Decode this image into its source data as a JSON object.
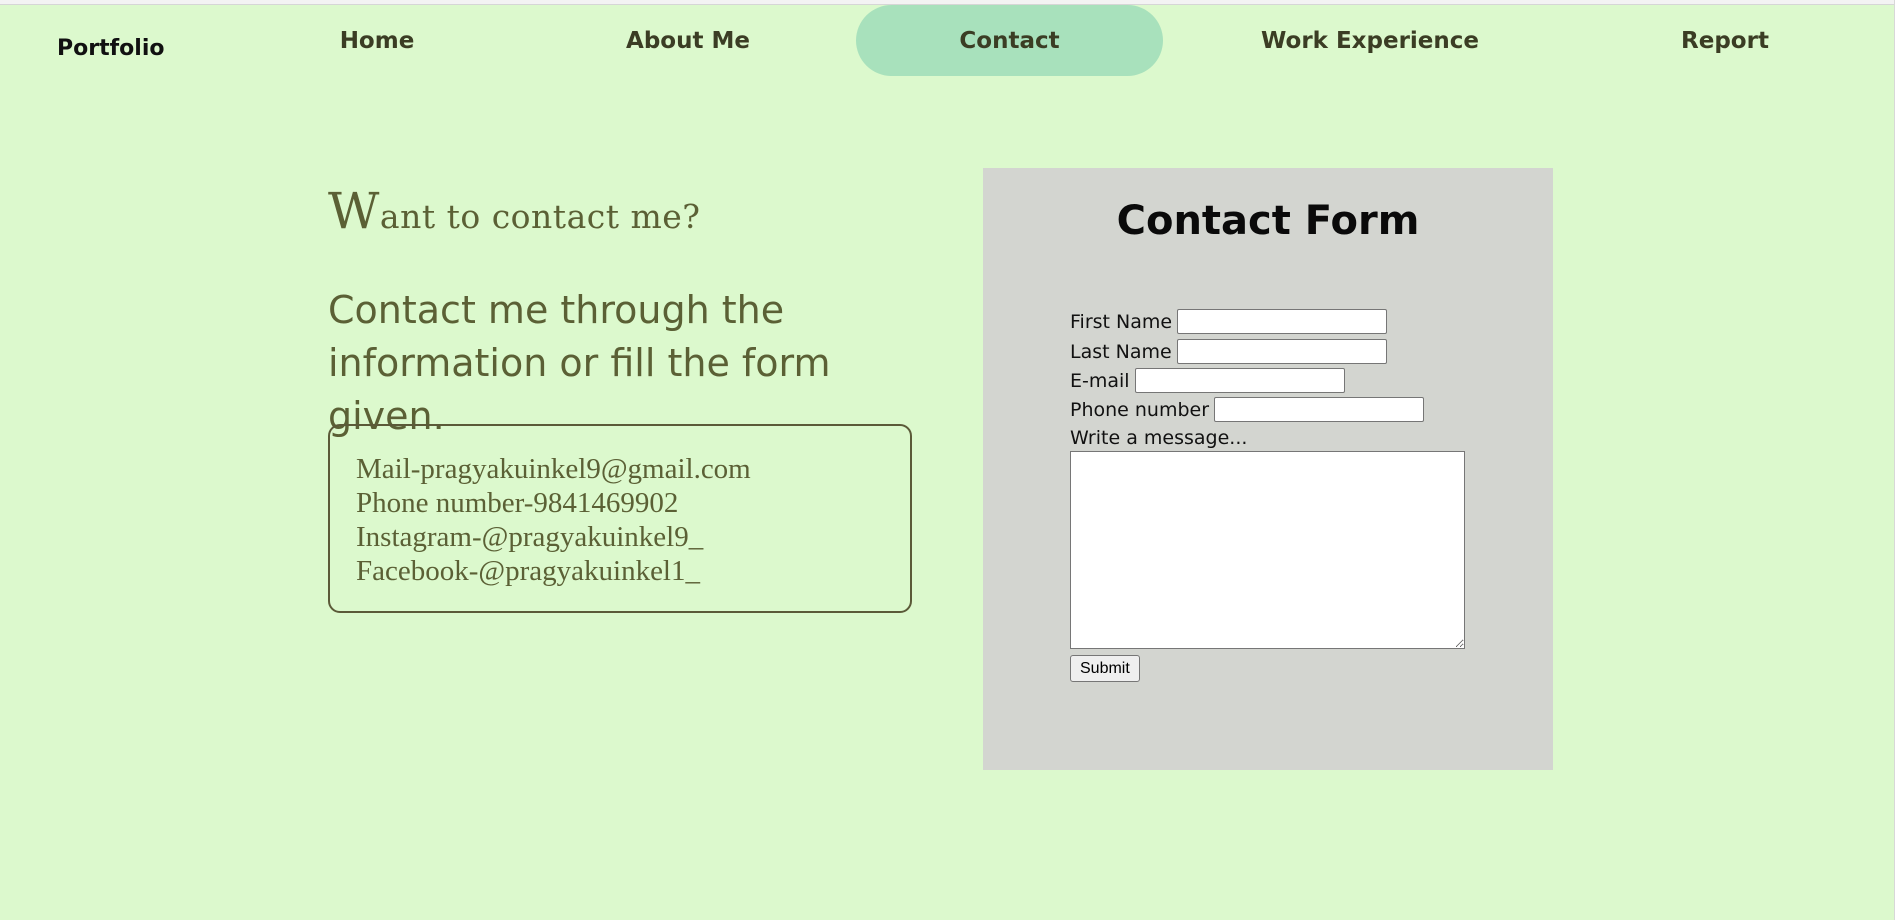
{
  "brand": "Portfolio",
  "nav": {
    "home": "Home",
    "about": "About Me",
    "contact": "Contact",
    "work": "Work Experience",
    "report": "Report"
  },
  "intro": {
    "heading_first": "W",
    "heading_rest": "ant to contact me?",
    "subtext": "Contact me through the information or fill the form given."
  },
  "contact_info": {
    "mail": "Mail-pragyakuinkel9@gmail.com",
    "phone": "Phone number-9841469902",
    "instagram": "Instagram-@pragyakuinkel9_",
    "facebook": "Facebook-@pragyakuinkel1_"
  },
  "form": {
    "title": "Contact Form",
    "first_name_label": "First Name",
    "first_name_value": "",
    "last_name_label": "Last Name",
    "last_name_value": "",
    "email_label": "E-mail",
    "email_value": "",
    "phone_label": "Phone number",
    "phone_value": "",
    "message_label": "Write a message...",
    "message_value": "",
    "submit_label": "Submit"
  },
  "colors": {
    "background": "#dcf9cd",
    "nav_active": "#a8e1bc",
    "form_panel": "#d3d5d0",
    "text_olive": "#5b6035"
  }
}
